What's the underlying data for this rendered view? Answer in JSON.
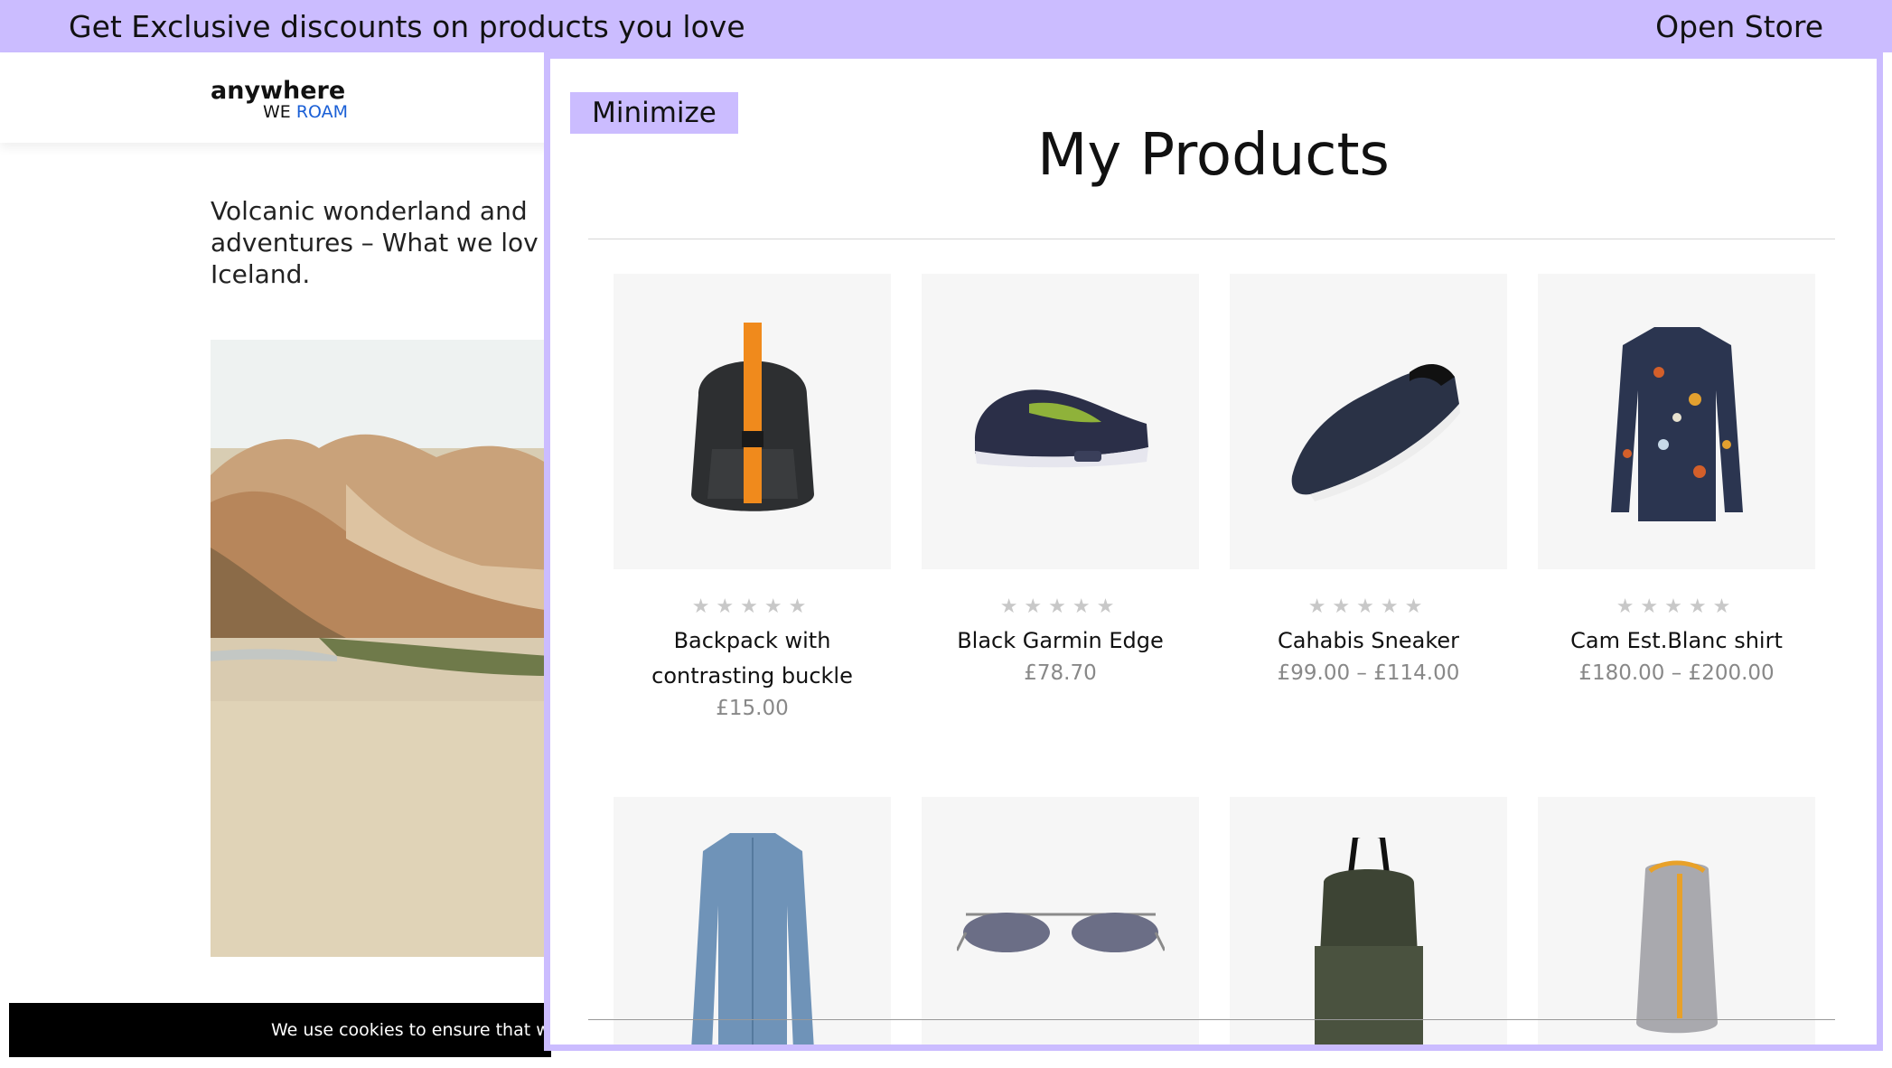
{
  "banner": {
    "promo_text": "Get Exclusive discounts on products you love",
    "open_store_label": "Open Store"
  },
  "site": {
    "logo_line1": "anywhere",
    "logo_we": "WE",
    "logo_roam": "ROAM",
    "article_lines": [
      "Volcanic wonderland and",
      "adventures – What we lov",
      "Iceland."
    ],
    "cookie_text": "We use cookies to ensure that w"
  },
  "panel": {
    "minimize_label": "Minimize",
    "title": "My Products",
    "rating_stars": "★★★★★",
    "products": [
      {
        "name": "Backpack with contrasting buckle",
        "price": "£15.00",
        "icon": "backpack-icon"
      },
      {
        "name": "Black Garmin Edge",
        "price": "£78.70",
        "icon": "sneaker-icon"
      },
      {
        "name": "Cahabis Sneaker",
        "price": "£99.00 – £114.00",
        "icon": "slip-on-shoe-icon"
      },
      {
        "name": "Cam Est.Blanc shirt",
        "price": "£180.00 – £200.00",
        "icon": "floral-shirt-icon"
      },
      {
        "name": "",
        "price": "",
        "icon": "denim-shirt-icon"
      },
      {
        "name": "",
        "price": "",
        "icon": "sunglasses-icon"
      },
      {
        "name": "",
        "price": "",
        "icon": "green-backpack-icon"
      },
      {
        "name": "",
        "price": "",
        "icon": "grey-backpack-icon"
      }
    ]
  },
  "colors": {
    "accent": "#cbbcff",
    "logo_blue": "#1a5fd6",
    "price_grey": "#888888",
    "star_grey": "#c8c8c8"
  }
}
